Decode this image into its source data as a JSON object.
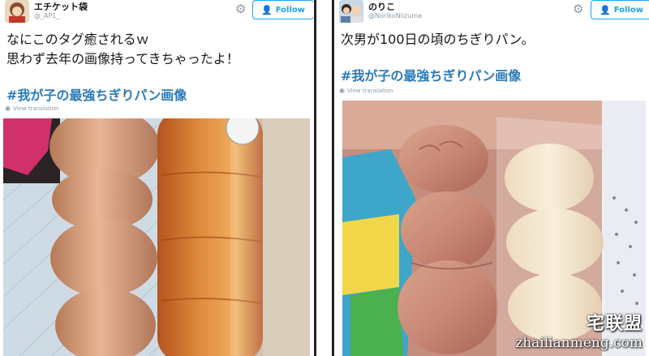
{
  "left_tweet": {
    "display_name": "エチケット袋",
    "handle": "@_AP1_",
    "follow_label": "Follow",
    "text_lines": [
      "なにこのタグ癒されるｗ",
      "思わず去年の画像持ってきちゃったよ！"
    ],
    "hashtag": "#我が子の最強ちぎりパン画像",
    "translate_label": "View translation",
    "icons": {
      "settings": "gear-icon",
      "follow": "add-user-icon",
      "translate": "globe-icon"
    }
  },
  "right_tweet": {
    "display_name": "のりこ",
    "handle": "@NorikoNiizuma",
    "follow_label": "Follow",
    "text_lines": [
      "次男が100日の頃のちぎりパン。"
    ],
    "hashtag": "#我が子の最強ちぎりパン画像",
    "translate_label": "View translation",
    "icons": {
      "settings": "gear-icon",
      "follow": "add-user-icon",
      "translate": "globe-icon"
    }
  },
  "watermark": {
    "brand": "宅联盟",
    "url": "zhailianmeng.com"
  },
  "colors": {
    "accent": "#1da1f2",
    "hashtag": "#2b7bb9",
    "muted": "#8899a6",
    "divider": "#222222"
  }
}
